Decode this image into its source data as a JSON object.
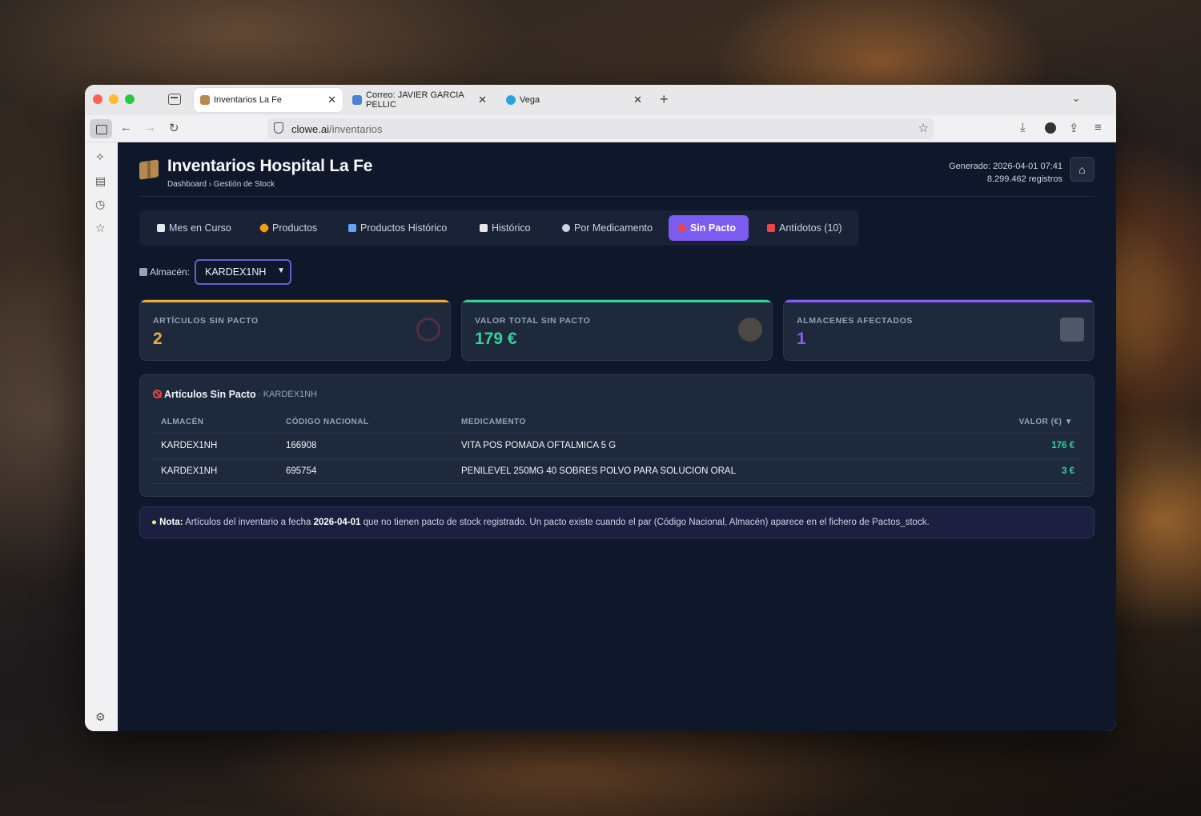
{
  "browser": {
    "tabs": [
      {
        "title": "Inventarios La Fe",
        "active": true
      },
      {
        "title": "Correo: JAVIER GARCIA PELLIC",
        "active": false
      },
      {
        "title": "Vega",
        "active": false
      }
    ],
    "url_host": "clowe.ai",
    "url_path": "/inventarios"
  },
  "header": {
    "title": "Inventarios Hospital La Fe",
    "breadcrumb": "Dashboard › Gestión de Stock",
    "generated": "Generado: 2026-04-01 07:41",
    "records": "8.299.462 registros"
  },
  "tabs": [
    {
      "label": "Mes en Curso",
      "icon": "calendar-icon"
    },
    {
      "label": "Productos",
      "icon": "pill-icon"
    },
    {
      "label": "Productos Histórico",
      "icon": "bar-chart-icon"
    },
    {
      "label": "Histórico",
      "icon": "line-chart-icon"
    },
    {
      "label": "Por Medicamento",
      "icon": "magnifier-icon"
    },
    {
      "label": "Sin Pacto",
      "icon": "no-entry-icon",
      "active": true
    },
    {
      "label": "Antídotos (10)",
      "icon": "siren-icon"
    }
  ],
  "filter": {
    "label": "Almacén:",
    "selected": "KARDEX1NH"
  },
  "cards": [
    {
      "label": "ARTÍCULOS SIN PACTO",
      "value": "2",
      "color": "#f0ad3c"
    },
    {
      "label": "VALOR TOTAL SIN PACTO",
      "value": "179 €",
      "color": "#34d399"
    },
    {
      "label": "ALMACENES AFECTADOS",
      "value": "1",
      "color": "#8b5cf6"
    }
  ],
  "table": {
    "title": "Artículos Sin Pacto",
    "subtitle": "· KARDEX1NH",
    "headers": [
      "ALMACÉN",
      "CÓDIGO NACIONAL",
      "MEDICAMENTO",
      "VALOR (€) ▼"
    ],
    "rows": [
      {
        "almacen": "KARDEX1NH",
        "codigo": "166908",
        "medicamento": "VITA POS POMADA OFTALMICA 5 G",
        "valor": "176 €"
      },
      {
        "almacen": "KARDEX1NH",
        "codigo": "695754",
        "medicamento": "PENILEVEL 250MG 40 SOBRES POLVO PARA SOLUCION ORAL",
        "valor": "3 €"
      }
    ]
  },
  "note": {
    "label": "Nota:",
    "text1": "Artículos del inventario a fecha",
    "date": "2026-04-01",
    "text2": "que no tienen pacto de stock registrado. Un pacto existe cuando el par (Código Nacional, Almacén) aparece en el fichero de Pactos_stock."
  }
}
